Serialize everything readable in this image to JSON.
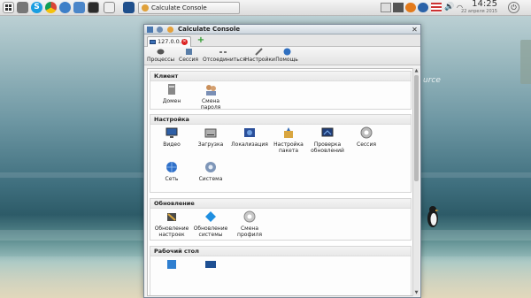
{
  "panel": {
    "launchers": [
      "apps-menu-icon",
      "settings-icon",
      "skype-icon",
      "chrome-icon",
      "blue-app-icon",
      "mail-icon",
      "terminal-icon",
      "window-icon",
      "calculate-icon"
    ],
    "task_label": "Calculate Console",
    "clock_time": "14:25",
    "clock_date": "22 апреля 2015"
  },
  "window": {
    "title": "Calculate Console",
    "tab_label": "127.0.0.1",
    "toolbar": [
      {
        "label": "Процессы",
        "icon": "processes-icon"
      },
      {
        "label": "Сессия",
        "icon": "session-icon"
      },
      {
        "label": "Отсоединиться",
        "icon": "disconnect-icon"
      },
      {
        "label": "Настройки",
        "icon": "settings-tools-icon"
      },
      {
        "label": "Помощь",
        "icon": "help-icon"
      }
    ],
    "groups": [
      {
        "title": "Клиент",
        "items": [
          {
            "label": "Домен",
            "icon": "domain-icon"
          },
          {
            "label": "Смена пароля",
            "icon": "change-password-icon"
          }
        ]
      },
      {
        "title": "Настройка",
        "items": [
          {
            "label": "Видео",
            "icon": "video-icon"
          },
          {
            "label": "Загрузка",
            "icon": "boot-icon"
          },
          {
            "label": "Локализация",
            "icon": "localization-icon"
          },
          {
            "label": "Настройка пакета",
            "icon": "package-settings-icon"
          },
          {
            "label": "Проверка обновлений",
            "icon": "check-updates-icon"
          },
          {
            "label": "Сессия",
            "icon": "session-gear-icon"
          },
          {
            "label": "Сеть",
            "icon": "network-icon"
          },
          {
            "label": "Система",
            "icon": "system-icon"
          }
        ]
      },
      {
        "title": "Обновление",
        "items": [
          {
            "label": "Обновление настроек",
            "icon": "update-settings-icon"
          },
          {
            "label": "Обновление системы",
            "icon": "update-system-icon"
          },
          {
            "label": "Смена профиля",
            "icon": "change-profile-icon"
          }
        ]
      },
      {
        "title": "Рабочий стол",
        "items": []
      }
    ]
  },
  "desktop": {
    "brand_text": "urce"
  },
  "colors": {
    "accent": "#3a6fb5",
    "panel": "#e6e6e6",
    "close": "#dd2222"
  }
}
